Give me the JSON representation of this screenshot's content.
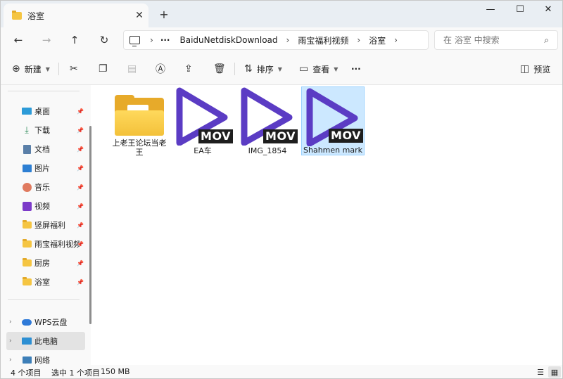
{
  "tab": {
    "title": "浴室",
    "close": "✕",
    "new": "+"
  },
  "window_controls": {
    "minimize": "—",
    "maximize": "☐",
    "close": "✕"
  },
  "nav": {
    "back": "←",
    "forward": "→",
    "up": "↑",
    "refresh": "↻",
    "chevron": "›",
    "more": "···"
  },
  "address": {
    "segments": [
      "BaiduNetdiskDownload",
      "雨宝福利视频",
      "浴室"
    ]
  },
  "search": {
    "placeholder": "在 浴室 中搜索",
    "icon": "⌕"
  },
  "commands": {
    "new_label": "新建",
    "sort_label": "排序",
    "view_label": "查看",
    "more": "···",
    "preview_label": "预览"
  },
  "sidebar": {
    "quick": [
      {
        "label": "桌面",
        "icon": "desktop-icon"
      },
      {
        "label": "下载",
        "icon": "download-icon"
      },
      {
        "label": "文档",
        "icon": "documents-icon"
      },
      {
        "label": "图片",
        "icon": "pictures-icon"
      },
      {
        "label": "音乐",
        "icon": "music-icon"
      },
      {
        "label": "视频",
        "icon": "videos-icon"
      },
      {
        "label": "竖屏福利",
        "icon": "folder-icon"
      },
      {
        "label": "雨宝福利视频",
        "icon": "folder-icon"
      },
      {
        "label": "厨房",
        "icon": "folder-icon"
      },
      {
        "label": "浴室",
        "icon": "folder-icon"
      }
    ],
    "tree": [
      {
        "label": "WPS云盘",
        "icon": "cloud-icon"
      },
      {
        "label": "此电脑",
        "icon": "computer-icon"
      },
      {
        "label": "网络",
        "icon": "network-icon"
      }
    ]
  },
  "files": [
    {
      "name": "上老王论坛当老王",
      "type": "folder"
    },
    {
      "name": "EA车",
      "type": "mov",
      "badge": "MOV"
    },
    {
      "name": "IMG_1854",
      "type": "mov",
      "badge": "MOV"
    },
    {
      "name": "Shahmen mark",
      "type": "mov",
      "badge": "MOV",
      "selected": true
    }
  ],
  "status": {
    "count": "4 个项目",
    "selection": "选中 1 个项目",
    "size": "150 MB"
  },
  "colors": {
    "accent": "#5b3cc4",
    "selection": "#cce8ff",
    "folder": "#f5c542"
  }
}
